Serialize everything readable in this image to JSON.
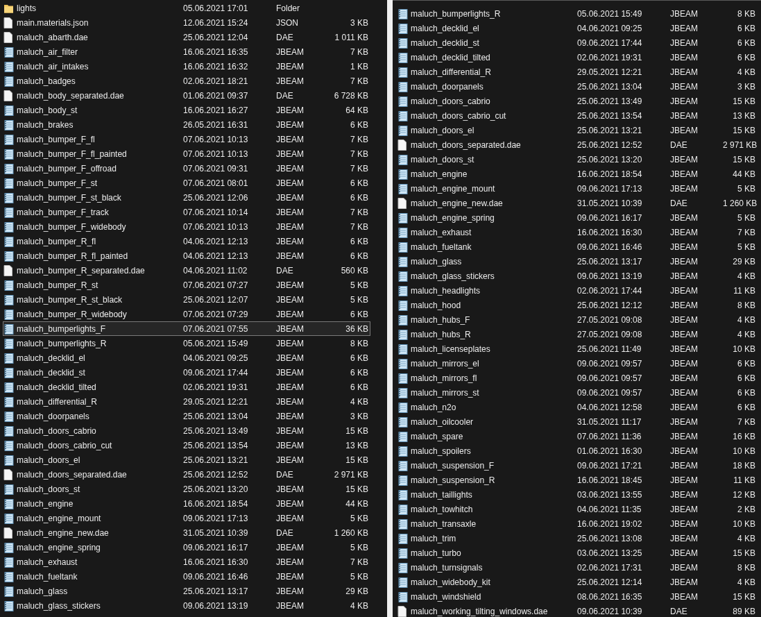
{
  "panes": [
    {
      "rows": [
        {
          "kind": "folder",
          "name": "lights",
          "date": "05.06.2021 17:01",
          "type": "Folder",
          "selected": false
        },
        {
          "kind": "file",
          "name": "main.materials.json",
          "date": "12.06.2021 15:24",
          "type": "JSON",
          "size": "3 KB",
          "selected": false
        },
        {
          "kind": "file",
          "name": "maluch_abarth.dae",
          "date": "25.06.2021 12:04",
          "type": "DAE",
          "size": "1 011 KB",
          "selected": false
        },
        {
          "kind": "notes",
          "name": "maluch_air_filter",
          "date": "16.06.2021 16:35",
          "type": "JBEAM",
          "size": "7 KB",
          "selected": false
        },
        {
          "kind": "notes",
          "name": "maluch_air_intakes",
          "date": "16.06.2021 16:32",
          "type": "JBEAM",
          "size": "1 KB",
          "selected": false
        },
        {
          "kind": "notes",
          "name": "maluch_badges",
          "date": "02.06.2021 18:21",
          "type": "JBEAM",
          "size": "7 KB",
          "selected": false
        },
        {
          "kind": "file",
          "name": "maluch_body_separated.dae",
          "date": "01.06.2021 09:37",
          "type": "DAE",
          "size": "6 728 KB",
          "selected": false
        },
        {
          "kind": "notes",
          "name": "maluch_body_st",
          "date": "16.06.2021 16:27",
          "type": "JBEAM",
          "size": "64 KB",
          "selected": false
        },
        {
          "kind": "notes",
          "name": "maluch_brakes",
          "date": "26.05.2021 16:31",
          "type": "JBEAM",
          "size": "6 KB",
          "selected": false
        },
        {
          "kind": "notes",
          "name": "maluch_bumper_F_fl",
          "date": "07.06.2021 10:13",
          "type": "JBEAM",
          "size": "7 KB",
          "selected": false
        },
        {
          "kind": "notes",
          "name": "maluch_bumper_F_fl_painted",
          "date": "07.06.2021 10:13",
          "type": "JBEAM",
          "size": "7 KB",
          "selected": false
        },
        {
          "kind": "notes",
          "name": "maluch_bumper_F_offroad",
          "date": "07.06.2021 09:31",
          "type": "JBEAM",
          "size": "7 KB",
          "selected": false
        },
        {
          "kind": "notes",
          "name": "maluch_bumper_F_st",
          "date": "07.06.2021 08:01",
          "type": "JBEAM",
          "size": "6 KB",
          "selected": false
        },
        {
          "kind": "notes",
          "name": "maluch_bumper_F_st_black",
          "date": "25.06.2021 12:06",
          "type": "JBEAM",
          "size": "6 KB",
          "selected": false
        },
        {
          "kind": "notes",
          "name": "maluch_bumper_F_track",
          "date": "07.06.2021 10:14",
          "type": "JBEAM",
          "size": "7 KB",
          "selected": false
        },
        {
          "kind": "notes",
          "name": "maluch_bumper_F_widebody",
          "date": "07.06.2021 10:13",
          "type": "JBEAM",
          "size": "7 KB",
          "selected": false
        },
        {
          "kind": "notes",
          "name": "maluch_bumper_R_fl",
          "date": "04.06.2021 12:13",
          "type": "JBEAM",
          "size": "6 KB",
          "selected": false
        },
        {
          "kind": "notes",
          "name": "maluch_bumper_R_fl_painted",
          "date": "04.06.2021 12:13",
          "type": "JBEAM",
          "size": "6 KB",
          "selected": false
        },
        {
          "kind": "file",
          "name": "maluch_bumper_R_separated.dae",
          "date": "04.06.2021 11:02",
          "type": "DAE",
          "size": "560 KB",
          "selected": false
        },
        {
          "kind": "notes",
          "name": "maluch_bumper_R_st",
          "date": "07.06.2021 07:27",
          "type": "JBEAM",
          "size": "5 KB",
          "selected": false
        },
        {
          "kind": "notes",
          "name": "maluch_bumper_R_st_black",
          "date": "25.06.2021 12:07",
          "type": "JBEAM",
          "size": "5 KB",
          "selected": false
        },
        {
          "kind": "notes",
          "name": "maluch_bumper_R_widebody",
          "date": "07.06.2021 07:29",
          "type": "JBEAM",
          "size": "6 KB",
          "selected": false
        },
        {
          "kind": "notes",
          "name": "maluch_bumperlights_F",
          "date": "07.06.2021 07:55",
          "type": "JBEAM",
          "size": "36 KB",
          "selected": true
        },
        {
          "kind": "notes",
          "name": "maluch_bumperlights_R",
          "date": "05.06.2021 15:49",
          "type": "JBEAM",
          "size": "8 KB",
          "selected": false
        },
        {
          "kind": "notes",
          "name": "maluch_decklid_el",
          "date": "04.06.2021 09:25",
          "type": "JBEAM",
          "size": "6 KB",
          "selected": false
        },
        {
          "kind": "notes",
          "name": "maluch_decklid_st",
          "date": "09.06.2021 17:44",
          "type": "JBEAM",
          "size": "6 KB",
          "selected": false
        },
        {
          "kind": "notes",
          "name": "maluch_decklid_tilted",
          "date": "02.06.2021 19:31",
          "type": "JBEAM",
          "size": "6 KB",
          "selected": false
        },
        {
          "kind": "notes",
          "name": "maluch_differential_R",
          "date": "29.05.2021 12:21",
          "type": "JBEAM",
          "size": "4 KB",
          "selected": false
        },
        {
          "kind": "notes",
          "name": "maluch_doorpanels",
          "date": "25.06.2021 13:04",
          "type": "JBEAM",
          "size": "3 KB",
          "selected": false
        },
        {
          "kind": "notes",
          "name": "maluch_doors_cabrio",
          "date": "25.06.2021 13:49",
          "type": "JBEAM",
          "size": "15 KB",
          "selected": false
        },
        {
          "kind": "notes",
          "name": "maluch_doors_cabrio_cut",
          "date": "25.06.2021 13:54",
          "type": "JBEAM",
          "size": "13 KB",
          "selected": false
        },
        {
          "kind": "notes",
          "name": "maluch_doors_el",
          "date": "25.06.2021 13:21",
          "type": "JBEAM",
          "size": "15 KB",
          "selected": false
        },
        {
          "kind": "file",
          "name": "maluch_doors_separated.dae",
          "date": "25.06.2021 12:52",
          "type": "DAE",
          "size": "2 971 KB",
          "selected": false
        },
        {
          "kind": "notes",
          "name": "maluch_doors_st",
          "date": "25.06.2021 13:20",
          "type": "JBEAM",
          "size": "15 KB",
          "selected": false
        },
        {
          "kind": "notes",
          "name": "maluch_engine",
          "date": "16.06.2021 18:54",
          "type": "JBEAM",
          "size": "44 KB",
          "selected": false
        },
        {
          "kind": "notes",
          "name": "maluch_engine_mount",
          "date": "09.06.2021 17:13",
          "type": "JBEAM",
          "size": "5 KB",
          "selected": false
        },
        {
          "kind": "file",
          "name": "maluch_engine_new.dae",
          "date": "31.05.2021 10:39",
          "type": "DAE",
          "size": "1 260 KB",
          "selected": false
        },
        {
          "kind": "notes",
          "name": "maluch_engine_spring",
          "date": "09.06.2021 16:17",
          "type": "JBEAM",
          "size": "5 KB",
          "selected": false
        },
        {
          "kind": "notes",
          "name": "maluch_exhaust",
          "date": "16.06.2021 16:30",
          "type": "JBEAM",
          "size": "7 KB",
          "selected": false
        },
        {
          "kind": "notes",
          "name": "maluch_fueltank",
          "date": "09.06.2021 16:46",
          "type": "JBEAM",
          "size": "5 KB",
          "selected": false
        },
        {
          "kind": "notes",
          "name": "maluch_glass",
          "date": "25.06.2021 13:17",
          "type": "JBEAM",
          "size": "29 KB",
          "selected": false
        },
        {
          "kind": "notes",
          "name": "maluch_glass_stickers",
          "date": "09.06.2021 13:19",
          "type": "JBEAM",
          "size": "4 KB",
          "selected": false
        }
      ]
    },
    {
      "rows": [
        {
          "kind": "notes",
          "name": "maluch_bumperlights_R",
          "date": "05.06.2021 15:49",
          "type": "JBEAM",
          "size": "8 KB",
          "selected": false
        },
        {
          "kind": "notes",
          "name": "maluch_decklid_el",
          "date": "04.06.2021 09:25",
          "type": "JBEAM",
          "size": "6 KB",
          "selected": false
        },
        {
          "kind": "notes",
          "name": "maluch_decklid_st",
          "date": "09.06.2021 17:44",
          "type": "JBEAM",
          "size": "6 KB",
          "selected": false
        },
        {
          "kind": "notes",
          "name": "maluch_decklid_tilted",
          "date": "02.06.2021 19:31",
          "type": "JBEAM",
          "size": "6 KB",
          "selected": false
        },
        {
          "kind": "notes",
          "name": "maluch_differential_R",
          "date": "29.05.2021 12:21",
          "type": "JBEAM",
          "size": "4 KB",
          "selected": false
        },
        {
          "kind": "notes",
          "name": "maluch_doorpanels",
          "date": "25.06.2021 13:04",
          "type": "JBEAM",
          "size": "3 KB",
          "selected": false
        },
        {
          "kind": "notes",
          "name": "maluch_doors_cabrio",
          "date": "25.06.2021 13:49",
          "type": "JBEAM",
          "size": "15 KB",
          "selected": false
        },
        {
          "kind": "notes",
          "name": "maluch_doors_cabrio_cut",
          "date": "25.06.2021 13:54",
          "type": "JBEAM",
          "size": "13 KB",
          "selected": false
        },
        {
          "kind": "notes",
          "name": "maluch_doors_el",
          "date": "25.06.2021 13:21",
          "type": "JBEAM",
          "size": "15 KB",
          "selected": false
        },
        {
          "kind": "file",
          "name": "maluch_doors_separated.dae",
          "date": "25.06.2021 12:52",
          "type": "DAE",
          "size": "2 971 KB",
          "selected": false
        },
        {
          "kind": "notes",
          "name": "maluch_doors_st",
          "date": "25.06.2021 13:20",
          "type": "JBEAM",
          "size": "15 KB",
          "selected": false
        },
        {
          "kind": "notes",
          "name": "maluch_engine",
          "date": "16.06.2021 18:54",
          "type": "JBEAM",
          "size": "44 KB",
          "selected": false
        },
        {
          "kind": "notes",
          "name": "maluch_engine_mount",
          "date": "09.06.2021 17:13",
          "type": "JBEAM",
          "size": "5 KB",
          "selected": false
        },
        {
          "kind": "file",
          "name": "maluch_engine_new.dae",
          "date": "31.05.2021 10:39",
          "type": "DAE",
          "size": "1 260 KB",
          "selected": false
        },
        {
          "kind": "notes",
          "name": "maluch_engine_spring",
          "date": "09.06.2021 16:17",
          "type": "JBEAM",
          "size": "5 KB",
          "selected": false
        },
        {
          "kind": "notes",
          "name": "maluch_exhaust",
          "date": "16.06.2021 16:30",
          "type": "JBEAM",
          "size": "7 KB",
          "selected": false
        },
        {
          "kind": "notes",
          "name": "maluch_fueltank",
          "date": "09.06.2021 16:46",
          "type": "JBEAM",
          "size": "5 KB",
          "selected": false
        },
        {
          "kind": "notes",
          "name": "maluch_glass",
          "date": "25.06.2021 13:17",
          "type": "JBEAM",
          "size": "29 KB",
          "selected": false
        },
        {
          "kind": "notes",
          "name": "maluch_glass_stickers",
          "date": "09.06.2021 13:19",
          "type": "JBEAM",
          "size": "4 KB",
          "selected": false
        },
        {
          "kind": "notes",
          "name": "maluch_headlights",
          "date": "02.06.2021 17:44",
          "type": "JBEAM",
          "size": "11 KB",
          "selected": false
        },
        {
          "kind": "notes",
          "name": "maluch_hood",
          "date": "25.06.2021 12:12",
          "type": "JBEAM",
          "size": "8 KB",
          "selected": false
        },
        {
          "kind": "notes",
          "name": "maluch_hubs_F",
          "date": "27.05.2021 09:08",
          "type": "JBEAM",
          "size": "4 KB",
          "selected": false
        },
        {
          "kind": "notes",
          "name": "maluch_hubs_R",
          "date": "27.05.2021 09:08",
          "type": "JBEAM",
          "size": "4 KB",
          "selected": false
        },
        {
          "kind": "notes",
          "name": "maluch_licenseplates",
          "date": "25.06.2021 11:49",
          "type": "JBEAM",
          "size": "10 KB",
          "selected": false
        },
        {
          "kind": "notes",
          "name": "maluch_mirrors_el",
          "date": "09.06.2021 09:57",
          "type": "JBEAM",
          "size": "6 KB",
          "selected": false
        },
        {
          "kind": "notes",
          "name": "maluch_mirrors_fl",
          "date": "09.06.2021 09:57",
          "type": "JBEAM",
          "size": "6 KB",
          "selected": false
        },
        {
          "kind": "notes",
          "name": "maluch_mirrors_st",
          "date": "09.06.2021 09:57",
          "type": "JBEAM",
          "size": "6 KB",
          "selected": false
        },
        {
          "kind": "notes",
          "name": "maluch_n2o",
          "date": "04.06.2021 12:58",
          "type": "JBEAM",
          "size": "6 KB",
          "selected": false
        },
        {
          "kind": "notes",
          "name": "maluch_oilcooler",
          "date": "31.05.2021 11:17",
          "type": "JBEAM",
          "size": "7 KB",
          "selected": false
        },
        {
          "kind": "notes",
          "name": "maluch_spare",
          "date": "07.06.2021 11:36",
          "type": "JBEAM",
          "size": "16 KB",
          "selected": false
        },
        {
          "kind": "notes",
          "name": "maluch_spoilers",
          "date": "01.06.2021 16:30",
          "type": "JBEAM",
          "size": "10 KB",
          "selected": false
        },
        {
          "kind": "notes",
          "name": "maluch_suspension_F",
          "date": "09.06.2021 17:21",
          "type": "JBEAM",
          "size": "18 KB",
          "selected": false
        },
        {
          "kind": "notes",
          "name": "maluch_suspension_R",
          "date": "16.06.2021 18:45",
          "type": "JBEAM",
          "size": "11 KB",
          "selected": false
        },
        {
          "kind": "notes",
          "name": "maluch_taillights",
          "date": "03.06.2021 13:55",
          "type": "JBEAM",
          "size": "12 KB",
          "selected": false
        },
        {
          "kind": "notes",
          "name": "maluch_towhitch",
          "date": "04.06.2021 11:35",
          "type": "JBEAM",
          "size": "2 KB",
          "selected": false
        },
        {
          "kind": "notes",
          "name": "maluch_transaxle",
          "date": "16.06.2021 19:02",
          "type": "JBEAM",
          "size": "10 KB",
          "selected": false
        },
        {
          "kind": "notes",
          "name": "maluch_trim",
          "date": "25.06.2021 13:08",
          "type": "JBEAM",
          "size": "4 KB",
          "selected": false
        },
        {
          "kind": "notes",
          "name": "maluch_turbo",
          "date": "03.06.2021 13:25",
          "type": "JBEAM",
          "size": "15 KB",
          "selected": false
        },
        {
          "kind": "notes",
          "name": "maluch_turnsignals",
          "date": "02.06.2021 17:31",
          "type": "JBEAM",
          "size": "8 KB",
          "selected": false
        },
        {
          "kind": "notes",
          "name": "maluch_widebody_kit",
          "date": "25.06.2021 12:14",
          "type": "JBEAM",
          "size": "4 KB",
          "selected": false
        },
        {
          "kind": "notes",
          "name": "maluch_windshield",
          "date": "08.06.2021 16:35",
          "type": "JBEAM",
          "size": "15 KB",
          "selected": false
        },
        {
          "kind": "file",
          "name": "maluch_working_tilting_windows.dae",
          "date": "09.06.2021 10:39",
          "type": "DAE",
          "size": "89 KB",
          "selected": false
        }
      ]
    }
  ]
}
